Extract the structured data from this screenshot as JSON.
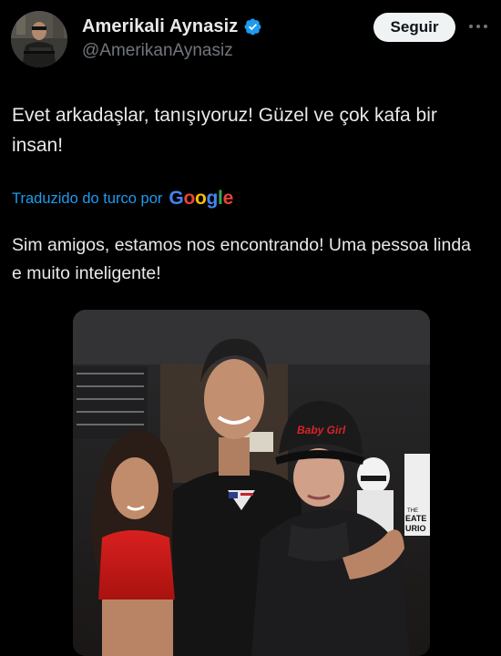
{
  "author": {
    "display_name": "Amerikali Aynasiz",
    "handle": "@AmerikanAynasiz",
    "verified": true
  },
  "actions": {
    "follow_label": "Seguir",
    "more_icon": "more-horizontal-icon"
  },
  "tweet": {
    "text": "Evet arkadaşlar, tanışıyoruz! Güzel ve çok kafa bir insan!",
    "translated_by_label": "Traduzido do turco por",
    "translation_provider": "Google",
    "translation": "Sim amigos, estamos nos encontrando! Uma pessoa linda e muito inteligente!"
  },
  "media": {
    "cap_text": "Baby Girl",
    "poster_text_1": "THE",
    "poster_text_2": "EATE",
    "poster_text_3": "URIO"
  },
  "colors": {
    "background": "#000000",
    "text_primary": "#e7e9ea",
    "text_secondary": "#71767b",
    "link_blue": "#1d9bf0",
    "verified_blue": "#1d9bf0",
    "follow_button_bg": "#eff3f4"
  }
}
